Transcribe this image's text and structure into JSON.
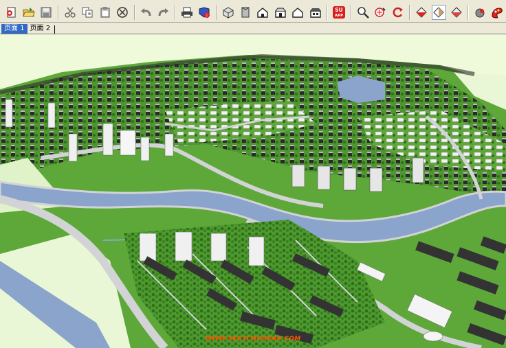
{
  "tabs": [
    {
      "label": "页面 1",
      "active": true
    },
    {
      "label": "页面 2",
      "active": false
    }
  ],
  "toolbar": {
    "su_app_line1": "SU",
    "su_app_line2": "APP"
  },
  "watermark": "WWW.SKETCHUPBAR.COM",
  "colors": {
    "toolbar_bg": "#ece9d8",
    "active_tab": "#316ac5",
    "sky": "#eefad9",
    "grass": "#5ea83a",
    "river": "#8aa4cc",
    "road": "#d2d3d5"
  }
}
